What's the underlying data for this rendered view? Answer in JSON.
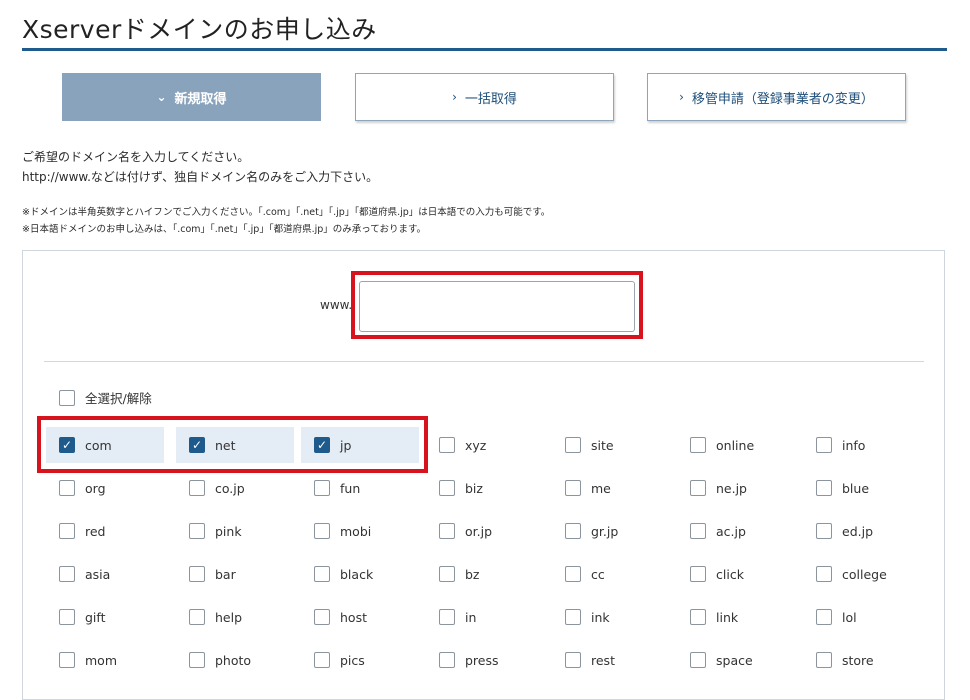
{
  "header": {
    "title": "Xserverドメインのお申し込み"
  },
  "tabs": [
    {
      "label": "新規取得",
      "chevron": "⌄"
    },
    {
      "label": "一括取得",
      "chevron": "›"
    },
    {
      "label": "移管申請（登録事業者の変更）",
      "chevron": "›"
    }
  ],
  "instructions": {
    "line1": "ご希望のドメイン名を入力してください。",
    "line2": "http://www.などは付けず、独自ドメイン名のみをご入力下さい。"
  },
  "notes": {
    "note1": "※ドメインは半角英数字とハイフンでご入力ください。「.com」「.net」「.jp」「都道府県.jp」は日本語での入力も可能です。",
    "note2": "※日本語ドメインのお申し込みは、「.com」「.net」「.jp」「都道府県.jp」のみ承っております。"
  },
  "search": {
    "prefix": "www.",
    "value": "",
    "placeholder": ""
  },
  "select_all": {
    "label": "全選択/解除",
    "checked": false
  },
  "colors": {
    "accent": "#1e5a8c",
    "active_tab": "#8aa3bd",
    "highlight": "#d7141e",
    "selected_bg": "#e4edf6"
  },
  "tlds": [
    [
      {
        "name": "com",
        "checked": true
      },
      {
        "name": "net",
        "checked": true
      },
      {
        "name": "jp",
        "checked": true
      },
      {
        "name": "xyz",
        "checked": false
      },
      {
        "name": "site",
        "checked": false
      },
      {
        "name": "online",
        "checked": false
      },
      {
        "name": "info",
        "checked": false
      }
    ],
    [
      {
        "name": "org",
        "checked": false
      },
      {
        "name": "co.jp",
        "checked": false
      },
      {
        "name": "fun",
        "checked": false
      },
      {
        "name": "biz",
        "checked": false
      },
      {
        "name": "me",
        "checked": false
      },
      {
        "name": "ne.jp",
        "checked": false
      },
      {
        "name": "blue",
        "checked": false
      }
    ],
    [
      {
        "name": "red",
        "checked": false
      },
      {
        "name": "pink",
        "checked": false
      },
      {
        "name": "mobi",
        "checked": false
      },
      {
        "name": "or.jp",
        "checked": false
      },
      {
        "name": "gr.jp",
        "checked": false
      },
      {
        "name": "ac.jp",
        "checked": false
      },
      {
        "name": "ed.jp",
        "checked": false
      }
    ],
    [
      {
        "name": "asia",
        "checked": false
      },
      {
        "name": "bar",
        "checked": false
      },
      {
        "name": "black",
        "checked": false
      },
      {
        "name": "bz",
        "checked": false
      },
      {
        "name": "cc",
        "checked": false
      },
      {
        "name": "click",
        "checked": false
      },
      {
        "name": "college",
        "checked": false
      }
    ],
    [
      {
        "name": "gift",
        "checked": false
      },
      {
        "name": "help",
        "checked": false
      },
      {
        "name": "host",
        "checked": false
      },
      {
        "name": "in",
        "checked": false
      },
      {
        "name": "ink",
        "checked": false
      },
      {
        "name": "link",
        "checked": false
      },
      {
        "name": "lol",
        "checked": false
      }
    ],
    [
      {
        "name": "mom",
        "checked": false
      },
      {
        "name": "photo",
        "checked": false
      },
      {
        "name": "pics",
        "checked": false
      },
      {
        "name": "press",
        "checked": false
      },
      {
        "name": "rest",
        "checked": false
      },
      {
        "name": "space",
        "checked": false
      },
      {
        "name": "store",
        "checked": false
      }
    ]
  ]
}
